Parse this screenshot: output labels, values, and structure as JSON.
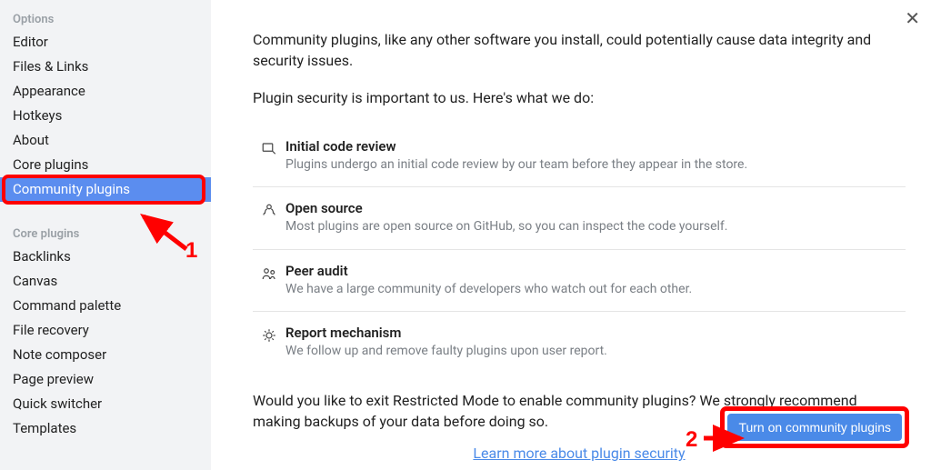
{
  "sidebar": {
    "groups": [
      {
        "title": "Options",
        "items": [
          {
            "label": "Editor"
          },
          {
            "label": "Files & Links"
          },
          {
            "label": "Appearance"
          },
          {
            "label": "Hotkeys"
          },
          {
            "label": "About"
          },
          {
            "label": "Core plugins"
          },
          {
            "label": "Community plugins",
            "active": true,
            "annotated": true
          }
        ]
      },
      {
        "title": "Core plugins",
        "items": [
          {
            "label": "Backlinks"
          },
          {
            "label": "Canvas"
          },
          {
            "label": "Command palette"
          },
          {
            "label": "File recovery"
          },
          {
            "label": "Note composer"
          },
          {
            "label": "Page preview"
          },
          {
            "label": "Quick switcher"
          },
          {
            "label": "Templates"
          }
        ]
      }
    ]
  },
  "content": {
    "intro": "Community plugins, like any other software you install, could potentially cause data integrity and security issues.",
    "security_line": "Plugin security is important to us. Here's what we do:",
    "features": [
      {
        "icon": "code-review-icon",
        "title": "Initial code review",
        "desc": "Plugins undergo an initial code review by our team before they appear in the store."
      },
      {
        "icon": "open-source-icon",
        "title": "Open source",
        "desc": "Most plugins are open source on GitHub, so you can inspect the code yourself."
      },
      {
        "icon": "peer-audit-icon",
        "title": "Peer audit",
        "desc": "We have a large community of developers who watch out for each other."
      },
      {
        "icon": "report-icon",
        "title": "Report mechanism",
        "desc": "We follow up and remove faulty plugins upon user report."
      }
    ],
    "exit_prompt": "Would you like to exit Restricted Mode to enable community plugins? We strongly recommend making backups of your data before doing so.",
    "learn_more": "Learn more about plugin security",
    "turn_on_button": "Turn on community plugins"
  },
  "annotations": {
    "num1": "1",
    "num2": "2"
  }
}
